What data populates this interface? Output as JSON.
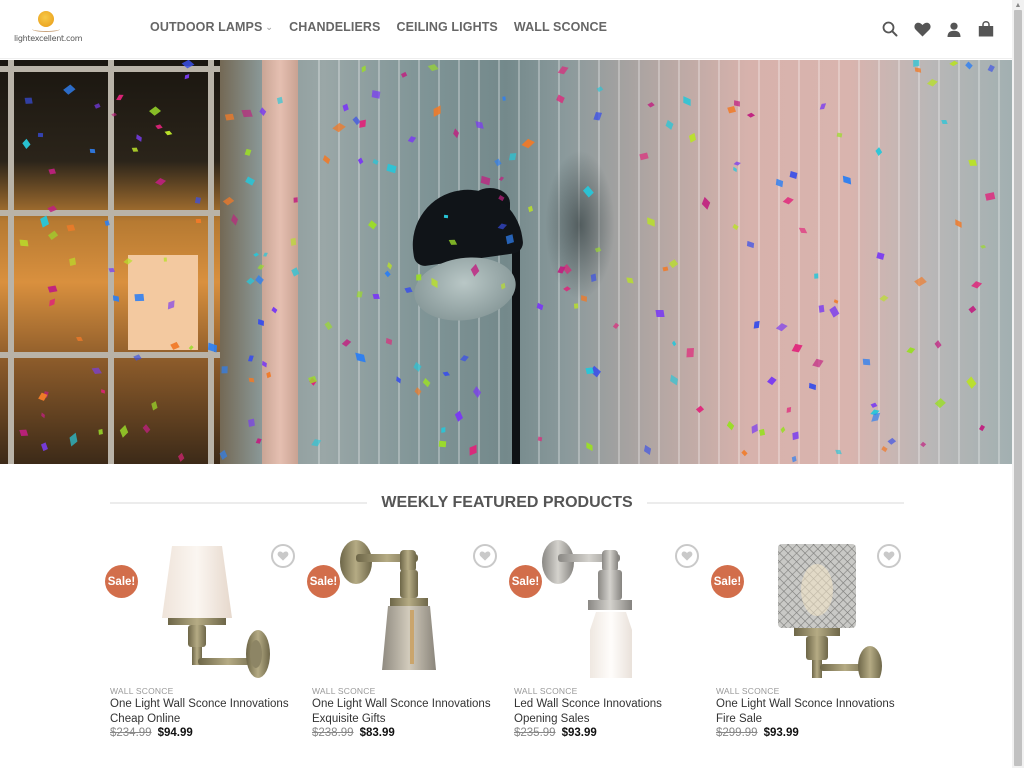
{
  "header": {
    "logo_text": "lightexcellent.com",
    "nav": [
      {
        "label": "OUTDOOR LAMPS",
        "has_dropdown": true
      },
      {
        "label": "CHANDELIERS",
        "has_dropdown": false
      },
      {
        "label": "CEILING LIGHTS",
        "has_dropdown": false
      },
      {
        "label": "WALL SCONCE",
        "has_dropdown": false
      }
    ],
    "icons": [
      "search-icon",
      "heart-icon",
      "user-icon",
      "shopping-bag-icon"
    ]
  },
  "hero": {
    "description": "Desk lamp against striped wall beside window with falling confetti"
  },
  "section": {
    "title": "WEEKLY FEATURED PRODUCTS"
  },
  "colors": {
    "sale_badge": "#d26e4b",
    "nav_text": "#666666",
    "price_new": "#111111"
  },
  "products": [
    {
      "badge": "Sale!",
      "category": "WALL SCONCE",
      "title": "One Light Wall Sconce Innovations Cheap Online",
      "old_price": "$234.99",
      "price": "$94.99"
    },
    {
      "badge": "Sale!",
      "category": "WALL SCONCE",
      "title": "One Light Wall Sconce Innovations Exquisite Gifts",
      "old_price": "$238.99",
      "price": "$83.99"
    },
    {
      "badge": "Sale!",
      "category": "WALL SCONCE",
      "title": "Led Wall Sconce Innovations Opening Sales",
      "old_price": "$235.99",
      "price": "$93.99"
    },
    {
      "badge": "Sale!",
      "category": "WALL SCONCE",
      "title": "One Light Wall Sconce Innovations Fire Sale",
      "old_price": "$299.99",
      "price": "$93.99"
    }
  ]
}
